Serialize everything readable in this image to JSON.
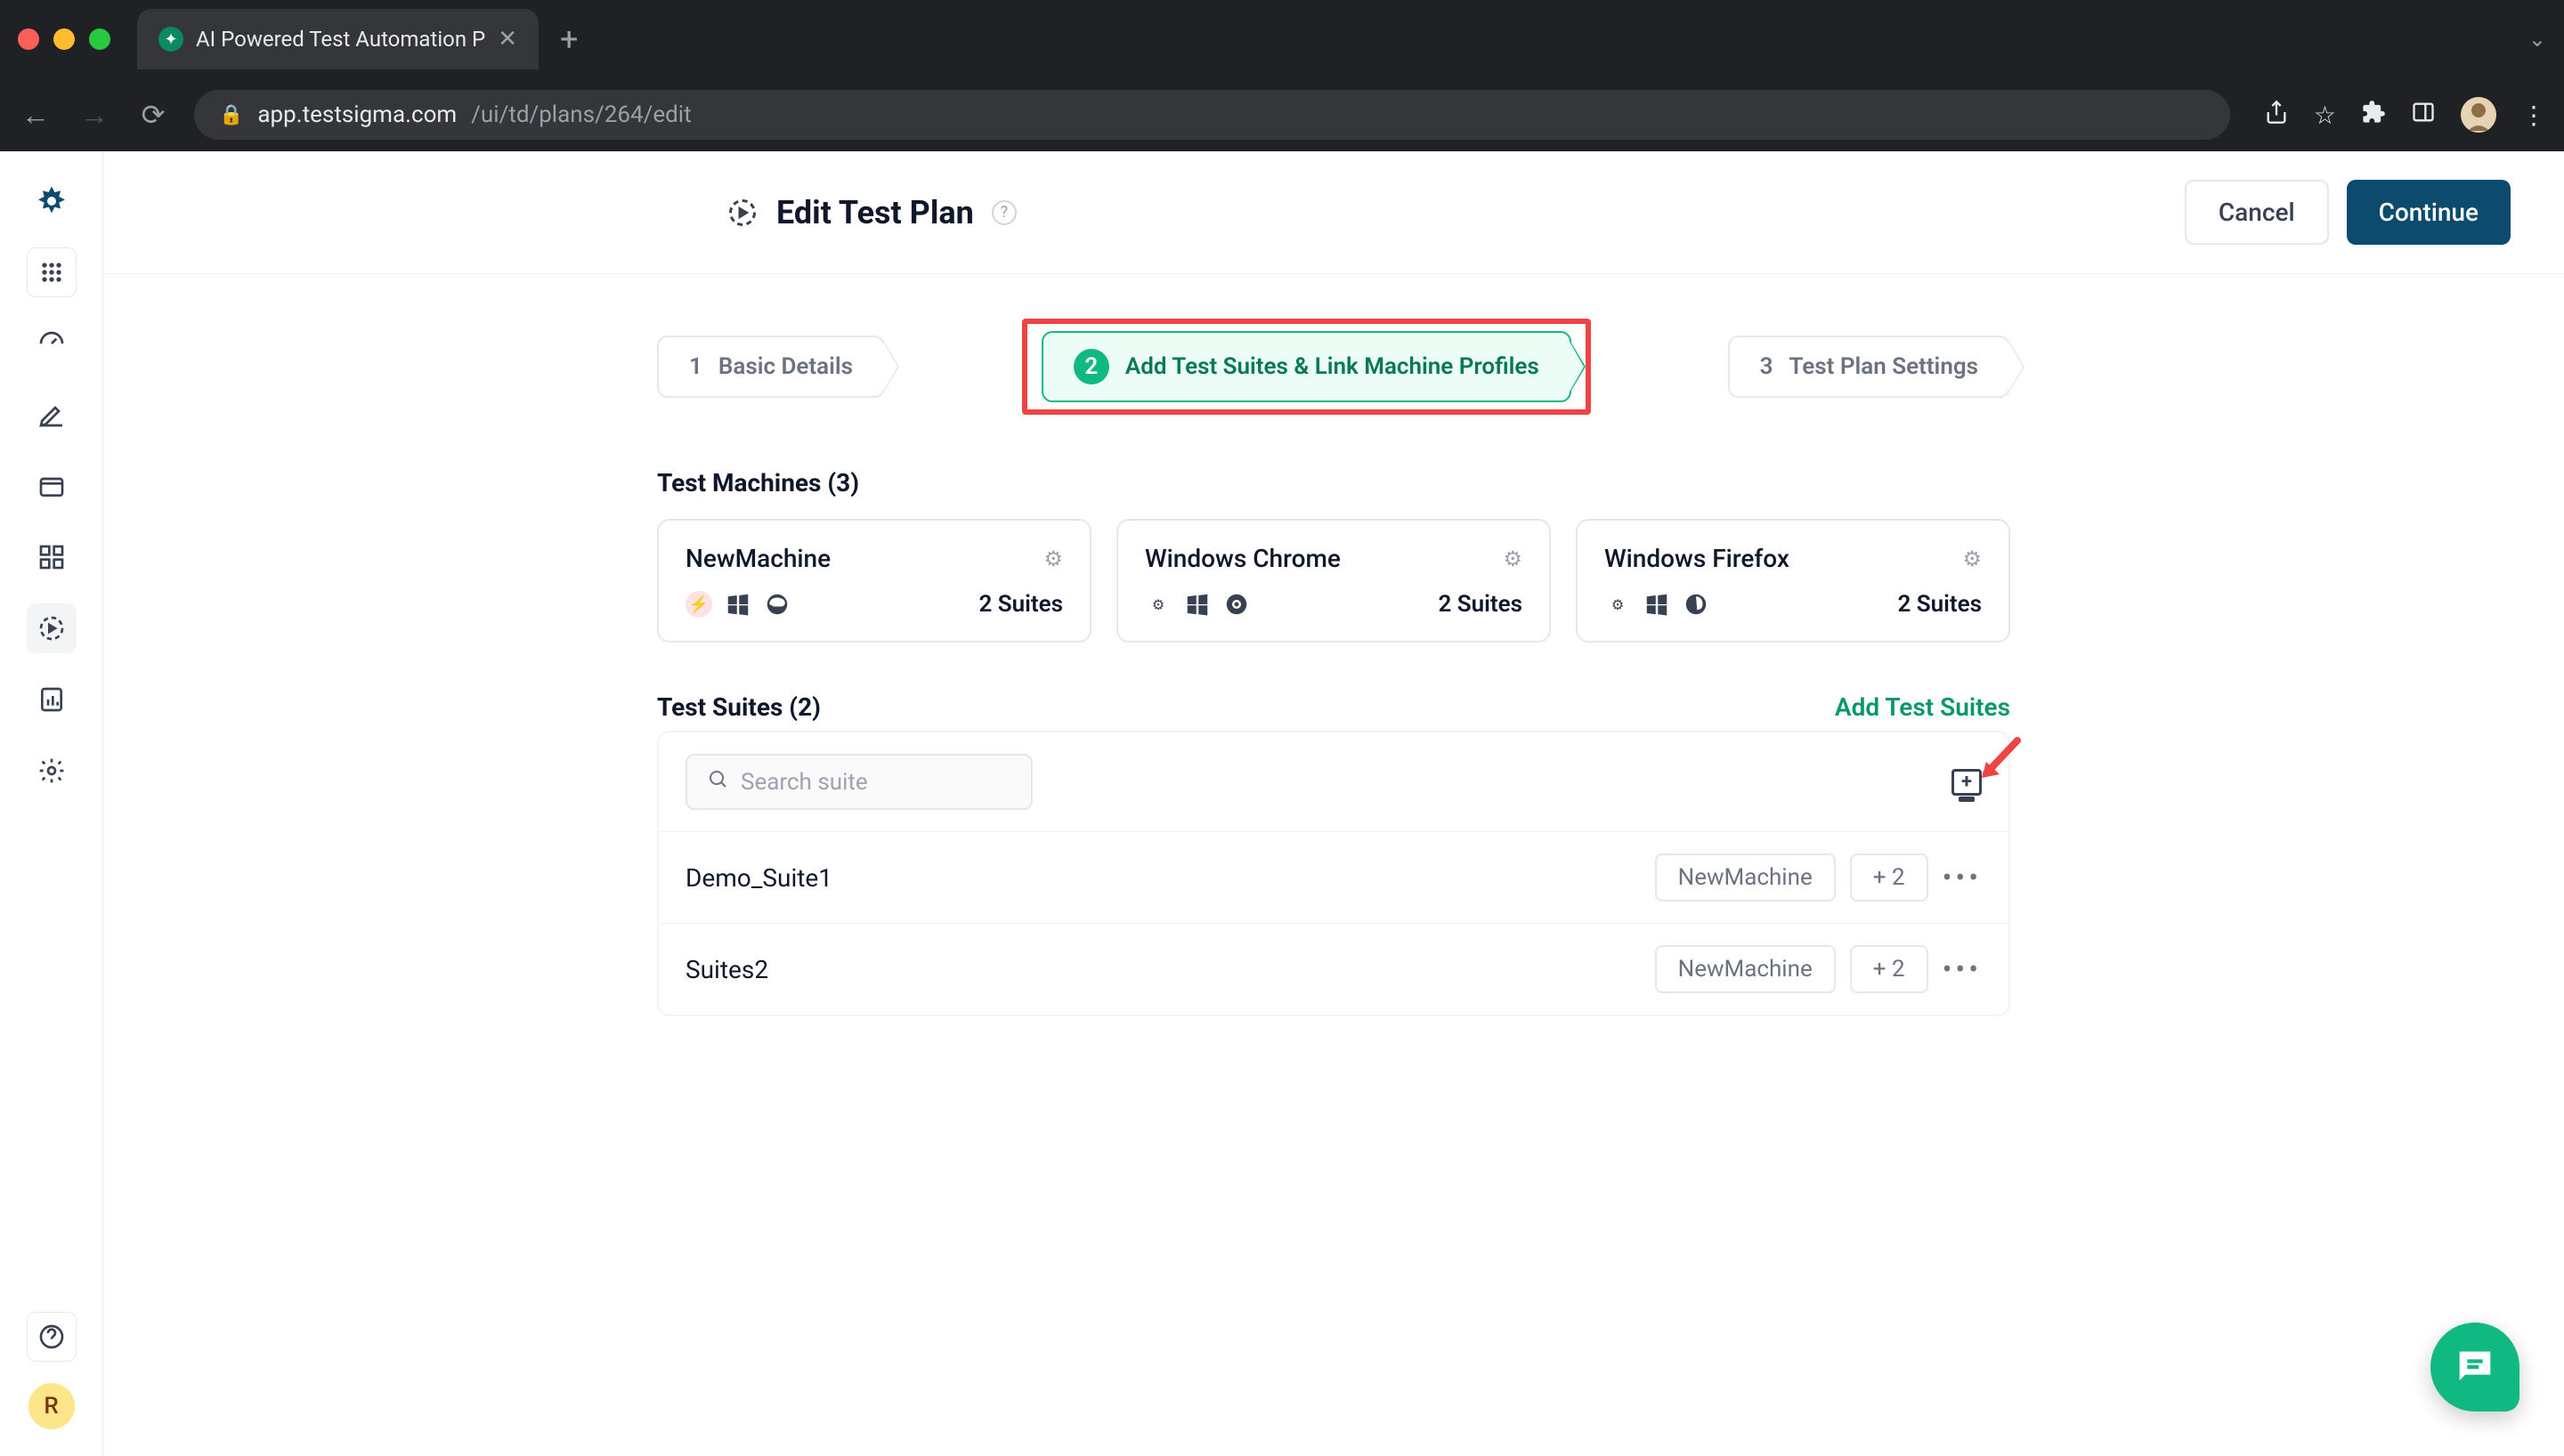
{
  "browser": {
    "tab_title": "AI Powered Test Automation P",
    "url_domain": "app.testsigma.com",
    "url_path": "/ui/td/plans/264/edit"
  },
  "header": {
    "title": "Edit Test Plan",
    "cancel": "Cancel",
    "continue": "Continue"
  },
  "steps": {
    "s1_num": "1",
    "s1_label": "Basic Details",
    "s2_num": "2",
    "s2_label": "Add Test Suites & Link Machine Profiles",
    "s3_num": "3",
    "s3_label": "Test Plan Settings"
  },
  "machines": {
    "title": "Test Machines (3)",
    "cards": [
      {
        "name": "NewMachine",
        "suites": "2 Suites",
        "icons": [
          "ts",
          "windows",
          "edge"
        ]
      },
      {
        "name": "Windows Chrome",
        "suites": "2 Suites",
        "icons": [
          "gear",
          "windows",
          "chrome"
        ]
      },
      {
        "name": "Windows Firefox",
        "suites": "2 Suites",
        "icons": [
          "gear",
          "windows",
          "firefox"
        ]
      }
    ]
  },
  "suites": {
    "title": "Test Suites (2)",
    "add_link": "Add Test Suites",
    "search_placeholder": "Search suite",
    "rows": [
      {
        "name": "Demo_Suite1",
        "machine": "NewMachine",
        "extra": "+ 2"
      },
      {
        "name": "Suites2",
        "machine": "NewMachine",
        "extra": "+ 2"
      }
    ]
  },
  "sidebar_avatar": "R"
}
